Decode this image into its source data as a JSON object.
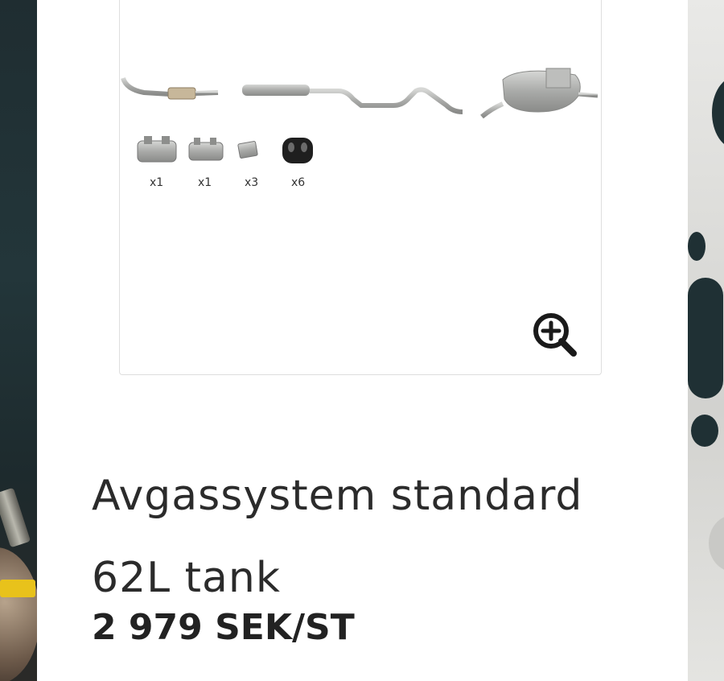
{
  "product": {
    "title_line1": "Avgassystem standard",
    "title_line2": "62L tank",
    "price": "2 979 SEK/ST",
    "image_alt": "Avgassystem",
    "parts": [
      {
        "qty": "x1",
        "icon": "clamp-icon"
      },
      {
        "qty": "x1",
        "icon": "clamp-icon"
      },
      {
        "qty": "x3",
        "icon": "bracket-icon"
      },
      {
        "qty": "x6",
        "icon": "rubber-hanger-icon"
      }
    ]
  },
  "controls": {
    "zoom_icon": "zoom-in-icon"
  },
  "colors": {
    "panel_bg": "#ffffff",
    "text": "#2b2b2b",
    "metal": "#a9aaa8"
  }
}
